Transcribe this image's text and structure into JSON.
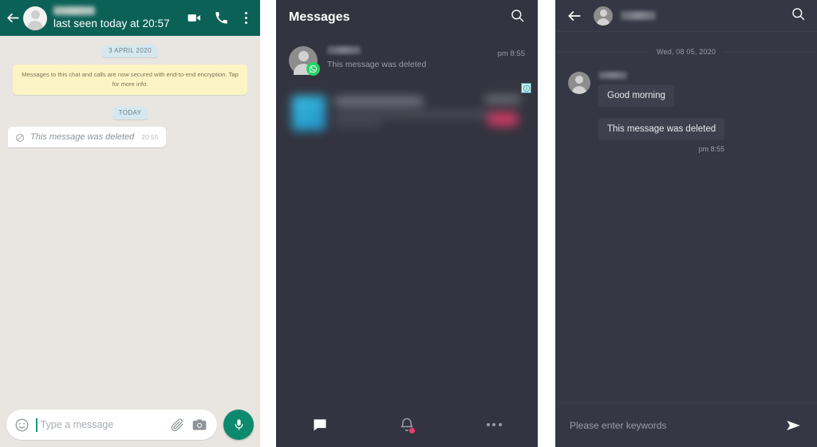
{
  "whatsapp": {
    "header": {
      "back_icon": "arrow-left-icon",
      "contact_name": "",
      "status": "last seen today at 20:57",
      "video_icon": "video-call-icon",
      "call_icon": "phone-call-icon",
      "menu_icon": "overflow-menu-icon"
    },
    "date_pill_1": "3 APRIL 2020",
    "encryption_notice": "Messages to this chat and calls are now secured with end-to-end encryption. Tap for more info.",
    "date_pill_2": "TODAY",
    "deleted_message": {
      "icon": "blocked-icon",
      "text": "This message was deleted",
      "time": "20:55"
    },
    "input": {
      "emoji_icon": "emoji-smiley-icon",
      "placeholder": "Type a message",
      "value": "",
      "attach_icon": "paperclip-icon",
      "camera_icon": "camera-icon",
      "mic_icon": "microphone-icon"
    }
  },
  "messages_app": {
    "header": {
      "title": "Messages",
      "search_icon": "search-icon"
    },
    "list": [
      {
        "avatar": "contact-avatar",
        "app_badge": "whatsapp-badge-icon",
        "name": "",
        "preview": "This message was deleted",
        "time": "pm 8:55"
      }
    ],
    "ad": {
      "info_badge": "ad-info-icon",
      "thumbnail": "ad-thumbnail",
      "title": "",
      "body": "",
      "cta": ""
    },
    "bottom_nav": [
      {
        "icon": "chat-bubble-icon",
        "label": "",
        "active": true,
        "badge": false
      },
      {
        "icon": "bell-icon",
        "label": "",
        "active": false,
        "badge": true
      },
      {
        "icon": "more-horizontal-icon",
        "label": "",
        "active": false,
        "badge": false
      }
    ]
  },
  "chat_app": {
    "header": {
      "back_icon": "arrow-left-icon",
      "avatar": "contact-avatar",
      "contact_name": "",
      "search_icon": "search-icon"
    },
    "date_divider": "Wed, 08 05, 2020",
    "messages": [
      {
        "sender": "",
        "text": "Good morning",
        "time": ""
      },
      {
        "sender": "",
        "text": "This message was deleted",
        "time": "pm 8:55"
      }
    ],
    "input": {
      "placeholder": "Please enter keywords",
      "value": "",
      "send_icon": "send-icon"
    }
  },
  "colors": {
    "whatsapp_header": "#0c6157",
    "whatsapp_chat_bg": "#e9e5e0",
    "whatsapp_accent": "#0b8a6e",
    "notice_yellow": "#fdf4c5",
    "date_pill_blue": "#d6e8ef",
    "dark_bg": "#33343f",
    "dark_bg_alt": "#353744",
    "bubble_dark": "#3e404d",
    "badge_pink": "#ef3b6c",
    "whatsapp_green": "#25d366"
  }
}
